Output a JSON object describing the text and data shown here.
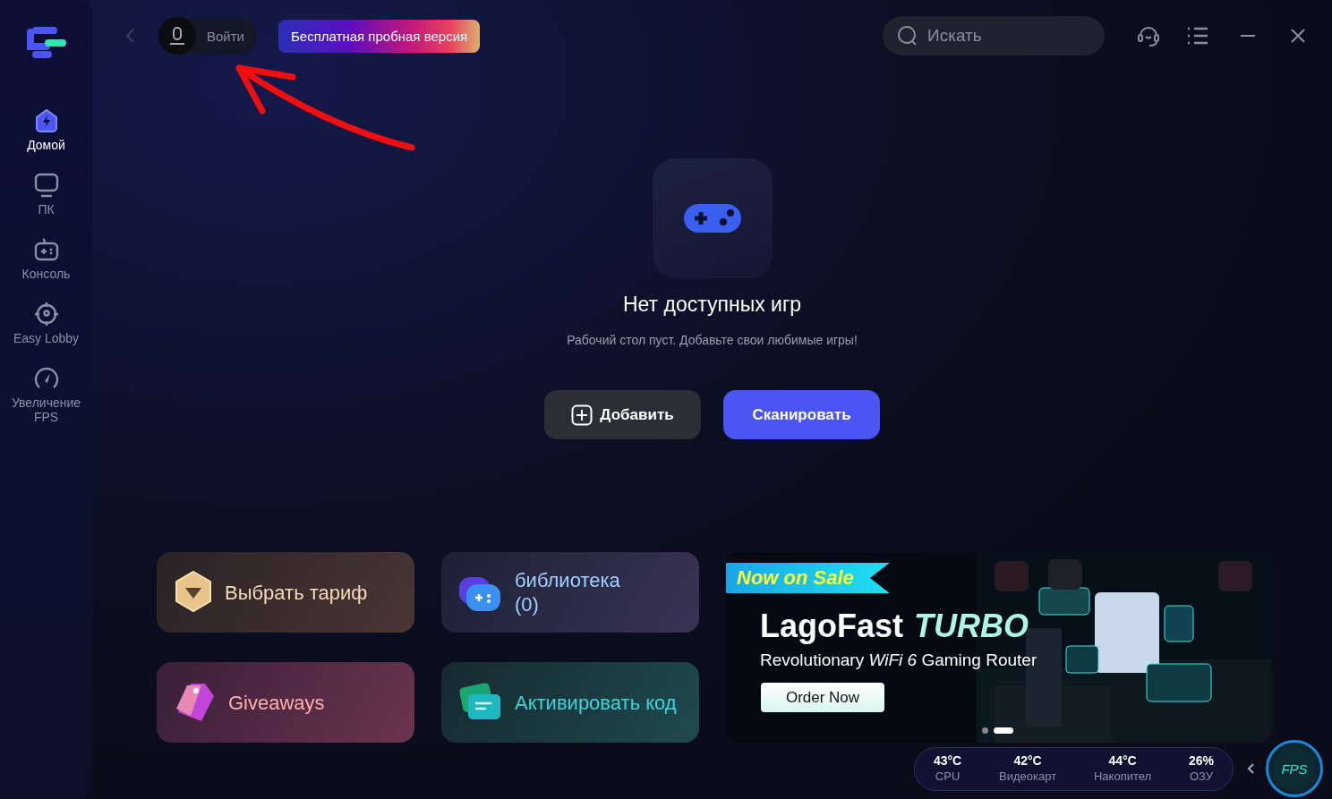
{
  "sidebar": {
    "items": [
      {
        "label": "Домой",
        "kind": "home",
        "selected": true
      },
      {
        "label": "ПК",
        "kind": "pc",
        "selected": false
      },
      {
        "label": "Консоль",
        "kind": "console",
        "selected": false
      },
      {
        "label": "Easy Lobby",
        "kind": "lobby",
        "selected": false
      },
      {
        "label": "Увеличение FPS",
        "kind": "boost",
        "selected": false
      }
    ]
  },
  "topbar": {
    "login": "Войти",
    "trial": "Бесплатная пробная версия",
    "search": {
      "placeholder": "Искать"
    }
  },
  "empty_state": {
    "title": "Нет доступных игр",
    "subtitle": "Рабочий стол пуст. Добавьте свои любимые игры!",
    "buttons": [
      {
        "label": "Добавить",
        "kind": "secondary"
      },
      {
        "label": "Сканировать",
        "kind": "primary"
      }
    ]
  },
  "tile_rows": [
    {
      "tiles": [
        {
          "label": "Выбрать тариф",
          "kind": "plan"
        },
        {
          "label": "библиотека (0)",
          "kind": "library"
        }
      ]
    },
    {
      "tiles": [
        {
          "label": "Giveaways",
          "kind": "giveaways"
        },
        {
          "label": "Активировать код",
          "kind": "code"
        }
      ]
    }
  ],
  "banner": {
    "badge": "Now on Sale",
    "brand": "LagoFast",
    "model": "TURBO",
    "tagline": "Revolutionary *WiFi 6* Gaming Router",
    "button": "Order Now",
    "dots": [
      {
        "selected": false
      },
      {
        "selected": true
      }
    ]
  },
  "stats": [
    {
      "value": "43°C",
      "label": "CPU"
    },
    {
      "value": "42°C",
      "label": "Видеокарт"
    },
    {
      "value": "44°C",
      "label": "Накопител"
    },
    {
      "value": "26%",
      "label": "ОЗУ"
    }
  ],
  "fps_badge": "FPS"
}
